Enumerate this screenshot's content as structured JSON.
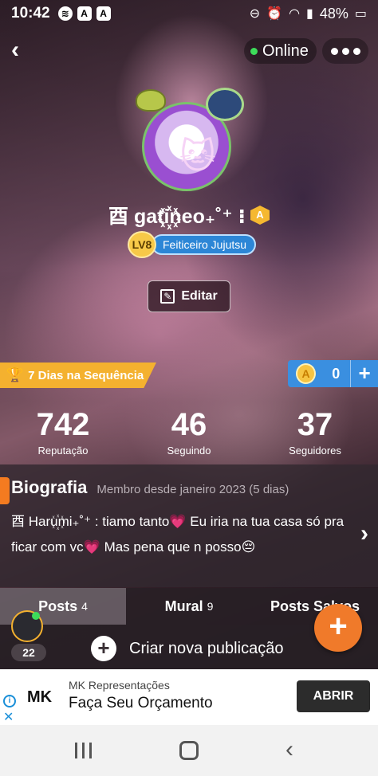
{
  "status_bar": {
    "time": "10:42",
    "battery": "48%",
    "icons": [
      "spotify-icon",
      "app-a-icon",
      "app-a-icon",
      "dnd-icon",
      "alarm-icon",
      "wifi-icon",
      "signal-icon",
      "battery-icon"
    ]
  },
  "header": {
    "online_label": "Online"
  },
  "profile": {
    "username": "酉 gati꙰neo₊˚⁺ ⁝",
    "level": "LV8",
    "title": "Feiticeiro Jujutsu",
    "edit_label": "Editar",
    "streak_label": "7 Dias na Sequência",
    "coins": "0"
  },
  "stats": [
    {
      "value": "742",
      "label": "Reputação"
    },
    {
      "value": "46",
      "label": "Seguindo"
    },
    {
      "value": "37",
      "label": "Seguidores"
    }
  ],
  "bio": {
    "title": "Biografia",
    "member_since": "Membro desde janeiro 2023 (5 dias)",
    "text": "酉 Haru꙰mi₊˚⁺ : tiamo tanto💗 Eu iria na tua casa só pra ficar com vc💗 Mas pena que n posso😔"
  },
  "tabs": [
    {
      "label": "Posts",
      "count": "4"
    },
    {
      "label": "Mural",
      "count": "9"
    },
    {
      "label": "Posts Salvos",
      "count": ""
    }
  ],
  "online_count": "22",
  "create_post_label": "Criar nova publicação",
  "ad": {
    "logo": "MK",
    "advertiser": "MK Representações",
    "headline": "Faça Seu Orçamento",
    "cta": "ABRIR"
  },
  "colors": {
    "accent_orange": "#f07a2a",
    "streak_yellow": "#f4b12f",
    "coins_blue": "#3a8fe0",
    "title_blue": "#2c86d6",
    "online_green": "#3ddc5a"
  }
}
